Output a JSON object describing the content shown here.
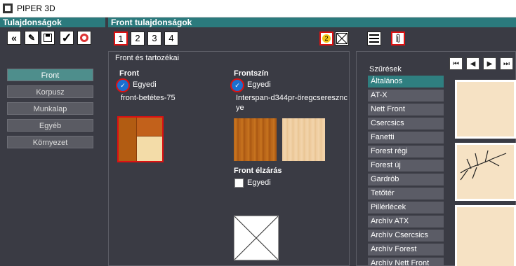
{
  "window": {
    "title": "PIPER 3D"
  },
  "left_header": "Tulajdonságok",
  "right_header": "Front tulajdonságok",
  "toolbar": {
    "icons": [
      "double-left-arrow-icon",
      "edit-icon",
      "save-icon",
      "checkmark-icon",
      "lifebuoy-icon"
    ],
    "tabs": [
      "1",
      "2",
      "3",
      "4"
    ],
    "help_badge": "2"
  },
  "sidebar": {
    "items": [
      {
        "label": "Front",
        "active": true
      },
      {
        "label": "Korpusz"
      },
      {
        "label": "Munkalap"
      },
      {
        "label": "Egyéb"
      },
      {
        "label": "Környezet"
      }
    ]
  },
  "panel": {
    "title": "Front és tartozékai",
    "front": {
      "title": "Front",
      "checkbox_label": "Egyedi",
      "value": "front-betétes-75"
    },
    "frontszin": {
      "title": "Frontszín",
      "checkbox_label": "Egyedi",
      "value_line1": "Interspan-d344pr-öregcseresznc",
      "value_line2": "ye"
    },
    "elzaras": {
      "title": "Front élzárás",
      "checkbox_label": "Egyedi"
    }
  },
  "filters": {
    "title": "Szűrések",
    "items": [
      "Általános",
      "AT-X",
      "Nett Front",
      "Csercsics",
      "Fanetti",
      "Forest régi",
      "Forest új",
      "Gardrób",
      "Tetőtér",
      "Pillérlécek",
      "Archív ATX",
      "Archív Csercsics",
      "Archív Forest",
      "Archív Nett Front"
    ]
  },
  "colors": {
    "accent": "#2b7a7d",
    "background": "#3a3b44",
    "highlight": "#cc1f1f",
    "wood": "#b9661a"
  }
}
